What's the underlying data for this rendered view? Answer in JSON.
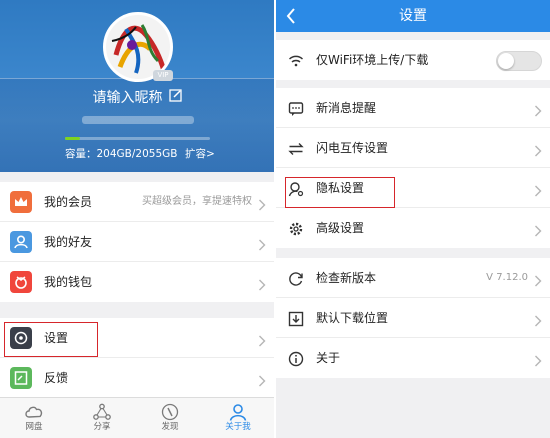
{
  "colors": {
    "accent": "#2b8ae6",
    "highlight": "#d6262b",
    "progress": "#7ed321",
    "vip_orange": "#f06e3c",
    "friends_blue": "#4a98e0",
    "wallet_red": "#f0463c",
    "settings_dark": "#3a3f4a",
    "feedback_green": "#5cb85c"
  },
  "profile": {
    "nickname_placeholder": "请输入昵称",
    "vip_badge": "VIP",
    "capacity": "容量：204GB/2055GB",
    "expand_label": "扩容>",
    "storage_used_fraction": 0.1
  },
  "left_menu": {
    "items": [
      {
        "label": "我的会员",
        "sub": "买超级会员，享提速特权",
        "icon": "crown-icon"
      },
      {
        "label": "我的好友",
        "sub": "",
        "icon": "person-icon"
      },
      {
        "label": "我的钱包",
        "sub": "",
        "icon": "wallet-icon"
      }
    ],
    "group2": [
      {
        "label": "设置",
        "icon": "settings-icon"
      },
      {
        "label": "反馈",
        "icon": "feedback-icon"
      }
    ]
  },
  "tabbar": {
    "tabs": [
      {
        "label": "网盘",
        "icon": "cloud-icon",
        "active": false
      },
      {
        "label": "分享",
        "icon": "share-icon",
        "active": false
      },
      {
        "label": "发现",
        "icon": "compass-icon",
        "active": false
      },
      {
        "label": "关于我",
        "icon": "user-icon",
        "active": true
      }
    ]
  },
  "settings": {
    "title": "设置",
    "wifi_only": {
      "label": "仅WiFi环境上传/下载",
      "enabled": false,
      "icon": "wifi-icon"
    },
    "group1": [
      {
        "label": "新消息提醒",
        "icon": "message-icon"
      },
      {
        "label": "闪电互传设置",
        "icon": "transfer-icon"
      },
      {
        "label": "隐私设置",
        "icon": "privacy-icon"
      },
      {
        "label": "高级设置",
        "icon": "gear-icon"
      }
    ],
    "group2": [
      {
        "label": "检查新版本",
        "value": "V 7.12.0",
        "icon": "refresh-icon"
      },
      {
        "label": "默认下载位置",
        "value": "",
        "icon": "download-icon"
      },
      {
        "label": "关于",
        "value": "",
        "icon": "info-icon"
      }
    ]
  }
}
